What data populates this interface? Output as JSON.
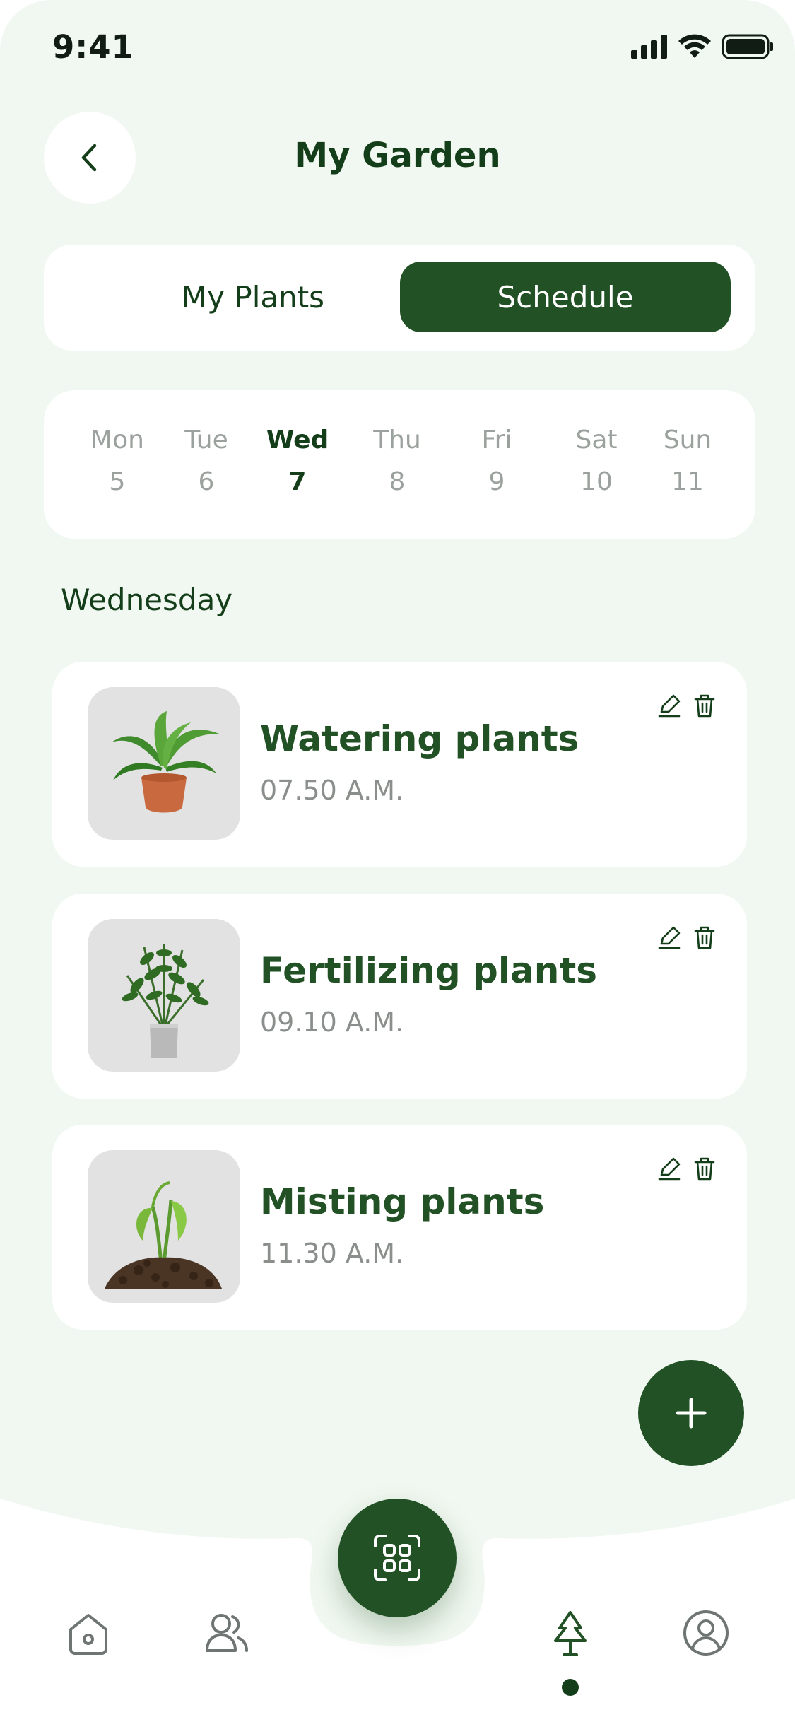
{
  "status_bar": {
    "time": "9:41"
  },
  "header": {
    "title": "My Garden",
    "back_icon": "chevron-left-icon"
  },
  "tabs": [
    {
      "label": "My Plants",
      "selected": false
    },
    {
      "label": "Schedule",
      "selected": true
    }
  ],
  "week": [
    {
      "day": "Mon",
      "date": "5",
      "selected": false
    },
    {
      "day": "Tue",
      "date": "6",
      "selected": false
    },
    {
      "day": "Wed",
      "date": "7",
      "selected": true
    },
    {
      "day": "Thu",
      "date": "8",
      "selected": false
    },
    {
      "day": "Fri",
      "date": "9",
      "selected": false
    },
    {
      "day": "Sat",
      "date": "10",
      "selected": false
    },
    {
      "day": "Sun",
      "date": "11",
      "selected": false
    }
  ],
  "section_title": "Wednesday",
  "tasks": [
    {
      "title": "Watering plants",
      "time": "07.50 A.M.",
      "image": "potted-fern-icon"
    },
    {
      "title": "Fertilizing plants",
      "time": "09.10 A.M.",
      "image": "zz-plant-icon"
    },
    {
      "title": "Misting plants",
      "time": "11.30 A.M.",
      "image": "seedling-in-soil-icon"
    }
  ],
  "colors": {
    "primary": "#215124",
    "background": "#f1f8f1",
    "text_dark": "#143d19",
    "muted": "#9ba29d"
  },
  "bottom_nav": {
    "items": [
      "home-icon",
      "community-icon",
      "scan-icon",
      "tree-icon",
      "profile-icon"
    ],
    "active": "tree-icon"
  }
}
